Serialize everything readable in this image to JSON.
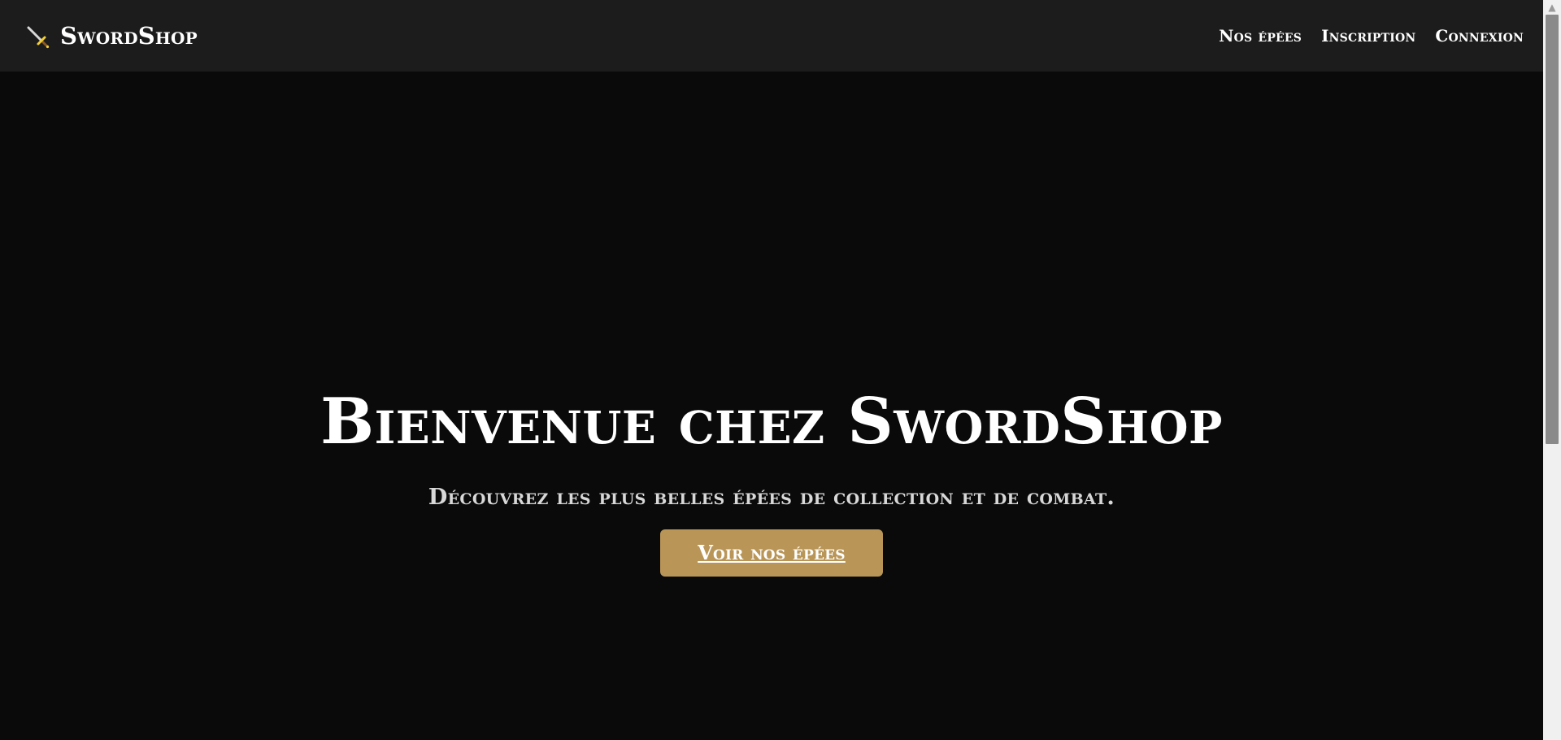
{
  "header": {
    "brand_name": "SwordShop",
    "brand_icon": "sword-icon",
    "nav": [
      {
        "label": "Nos épées"
      },
      {
        "label": "Inscription"
      },
      {
        "label": "Connexion"
      }
    ]
  },
  "hero": {
    "title": "Bienvenue chez SwordShop",
    "subtitle": "Découvrez les plus belles épées de collection et de combat.",
    "cta_label": "Voir nos épées"
  },
  "colors": {
    "navbar_bg": "#1c1c1c",
    "page_bg": "#0a0a0a",
    "accent": "#b99658",
    "text": "#ffffff"
  },
  "scrollbar": {
    "up_icon": "chevron-up-icon"
  }
}
